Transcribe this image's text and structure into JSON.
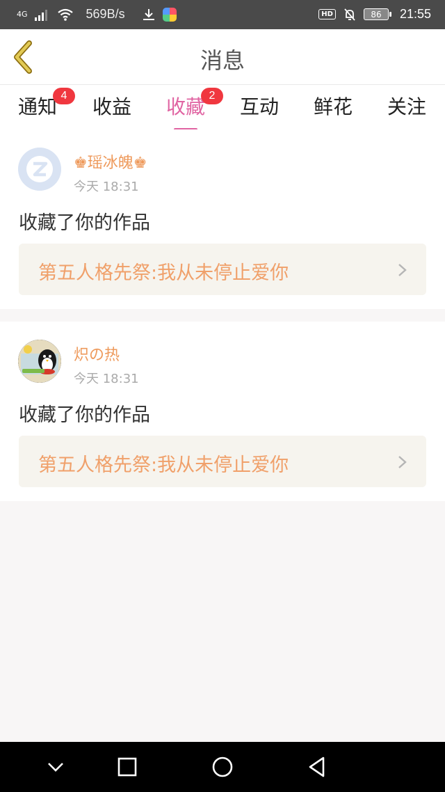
{
  "status_bar": {
    "network": "4G",
    "speed": "569B/s",
    "battery": "86",
    "hd": "HD",
    "time": "21:55"
  },
  "header": {
    "title": "消息",
    "back_icon": "chevron-left-icon"
  },
  "tabs": [
    {
      "label": "通知",
      "badge": "4",
      "active": false
    },
    {
      "label": "收益",
      "badge": "",
      "active": false
    },
    {
      "label": "收藏",
      "badge": "2",
      "active": true
    },
    {
      "label": "互动",
      "badge": "",
      "active": false
    },
    {
      "label": "鲜花",
      "badge": "",
      "active": false
    },
    {
      "label": "关注",
      "badge": "",
      "active": false
    }
  ],
  "messages": [
    {
      "user": "♚瑶冰魄♚",
      "time": "今天  18:31",
      "action": "收藏了你的作品",
      "work_title": "第五人格先祭:我从未停止爱你"
    },
    {
      "user": "炽の热",
      "time": "今天  18:31",
      "action": "收藏了你的作品",
      "work_title": "第五人格先祭:我从未停止爱你"
    }
  ],
  "colors": {
    "accent": "#e064a2",
    "username": "#ee9a5c",
    "work_title": "#f0a06a",
    "badge": "#f0373f",
    "back_icon": "#c9b44a"
  }
}
